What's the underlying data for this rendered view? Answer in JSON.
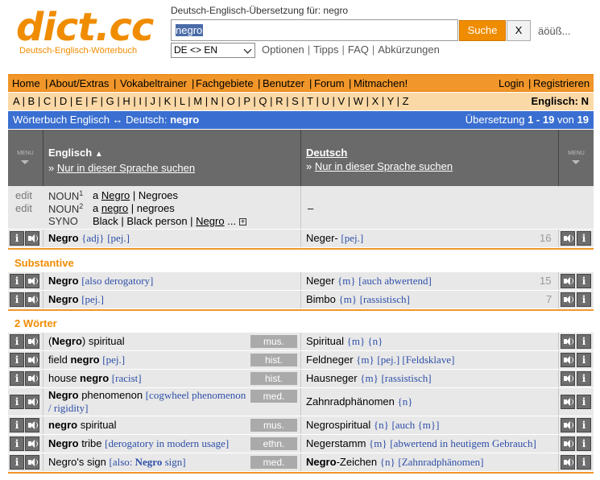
{
  "header": {
    "logo": "dict.cc",
    "logo_sub": "Deutsch-Englisch-Wörterbuch",
    "caption": "Deutsch-Englisch-Übersetzung für: negro",
    "search_value": "negro",
    "search_button": "Suche",
    "clear_button": "X",
    "special_chars": "äöüß...",
    "lang_select": "DE <> EN",
    "links": [
      "Optionen",
      "Tipps",
      "FAQ",
      "Abkürzungen"
    ]
  },
  "nav": {
    "left": [
      "Home",
      "About/Extras",
      "Vokabeltrainer",
      "Fachgebiete",
      "Benutzer",
      "Forum",
      "Mitmachen!"
    ],
    "right": [
      "Login",
      "Registrieren"
    ]
  },
  "alphabet": {
    "letters": "A | B | C | D | E | F | G | H | I | J | K | L | M | N | O | P | Q | R | S | T | U | V | W | X | Y | Z",
    "current": "Englisch: N"
  },
  "dict_bar": {
    "left_prefix": "Wörterbuch Englisch ↔ Deutsch:",
    "left_term": "negro",
    "right_prefix": "Übersetzung",
    "right_range": "1 - 19",
    "right_of": "von",
    "right_total": "19"
  },
  "columns": {
    "menu_label": "MENU",
    "en_title": "Englisch",
    "de_title": "Deutsch",
    "only_this_lang": "Nur in dieser Sprache suchen"
  },
  "synonyms": {
    "edit_label": "edit",
    "noun1_label": "NOUN",
    "noun1_sup": "1",
    "noun1_a": "a",
    "noun1_w1": "Negro",
    "noun1_w2": "Negroes",
    "noun2_label": "NOUN",
    "noun2_sup": "2",
    "noun2_a": "a",
    "noun2_w1": "negro",
    "noun2_w2": "negroes",
    "syno_label": "SYNO",
    "syno_w1": "Black",
    "syno_w2": "Black person",
    "syno_w3": "Negro",
    "syno_more": "...",
    "syno_plus": "+",
    "de_value": "–"
  },
  "sections": {
    "substantive": "Substantive",
    "two_words": "2 Wörter"
  },
  "icons": {
    "info": "i"
  },
  "entries": {
    "e1": {
      "en_b": "Negro",
      "en_g": "{adj}",
      "en_n": "[pej.]",
      "de": "Neger-",
      "de_n": "[pej.]",
      "count": "16"
    },
    "s1": {
      "en_b": "Negro",
      "en_n": "[also derogatory]",
      "de": "Neger",
      "de_g": "{m}",
      "de_n": "[auch abwertend]",
      "count": "15"
    },
    "s2": {
      "en_b": "Negro",
      "en_n": "[pej.]",
      "de": "Bimbo",
      "de_g": "{m}",
      "de_n": "[rassistisch]",
      "count": "7"
    },
    "w1": {
      "en_pre": "(",
      "en_b": "Negro",
      "en_post": ") spiritual",
      "tag": "mus.",
      "de": "Spiritual",
      "de_g": "{m} {n}"
    },
    "w2": {
      "en_pre": "field",
      "en_b": "negro",
      "en_n": "[pej.]",
      "tag": "hist.",
      "de": "Feldneger",
      "de_g": "{m}",
      "de_n": "[pej.] [Feldsklave]"
    },
    "w3": {
      "en_pre": "house",
      "en_b": "negro",
      "en_n": "[racist]",
      "tag": "hist.",
      "de": "Hausneger",
      "de_g": "{m}",
      "de_n": "[rassistisch]"
    },
    "w4": {
      "en_b": "Negro",
      "en_post": "phenomenon",
      "en_n1": "[cogwheel phenomenon",
      "en_n2": "/ rigidity]",
      "tag": "med.",
      "de": "Zahnradphänomen",
      "de_g": "{n}"
    },
    "w5": {
      "en_b": "negro",
      "en_post": "spiritual",
      "tag": "mus.",
      "de": "Negrospiritual",
      "de_g": "{n}",
      "de_n": "[auch {m}]"
    },
    "w6": {
      "en_b": "Negro",
      "en_post": "tribe",
      "en_n": "[derogatory in modern usage]",
      "tag": "ethn.",
      "de": "Negerstamm",
      "de_g": "{m}",
      "de_n": "[abwertend in heutigem Gebrauch]"
    },
    "w7": {
      "en_pre": "Negro's sign",
      "en_n_pre": "[also:",
      "en_n_b": "Negro",
      "en_n_post": "sign]",
      "tag": "med.",
      "de_b": "Negro",
      "de_post": "-Zeichen",
      "de_g": "{n}",
      "de_n": "[Zahnradphänomen]"
    }
  }
}
